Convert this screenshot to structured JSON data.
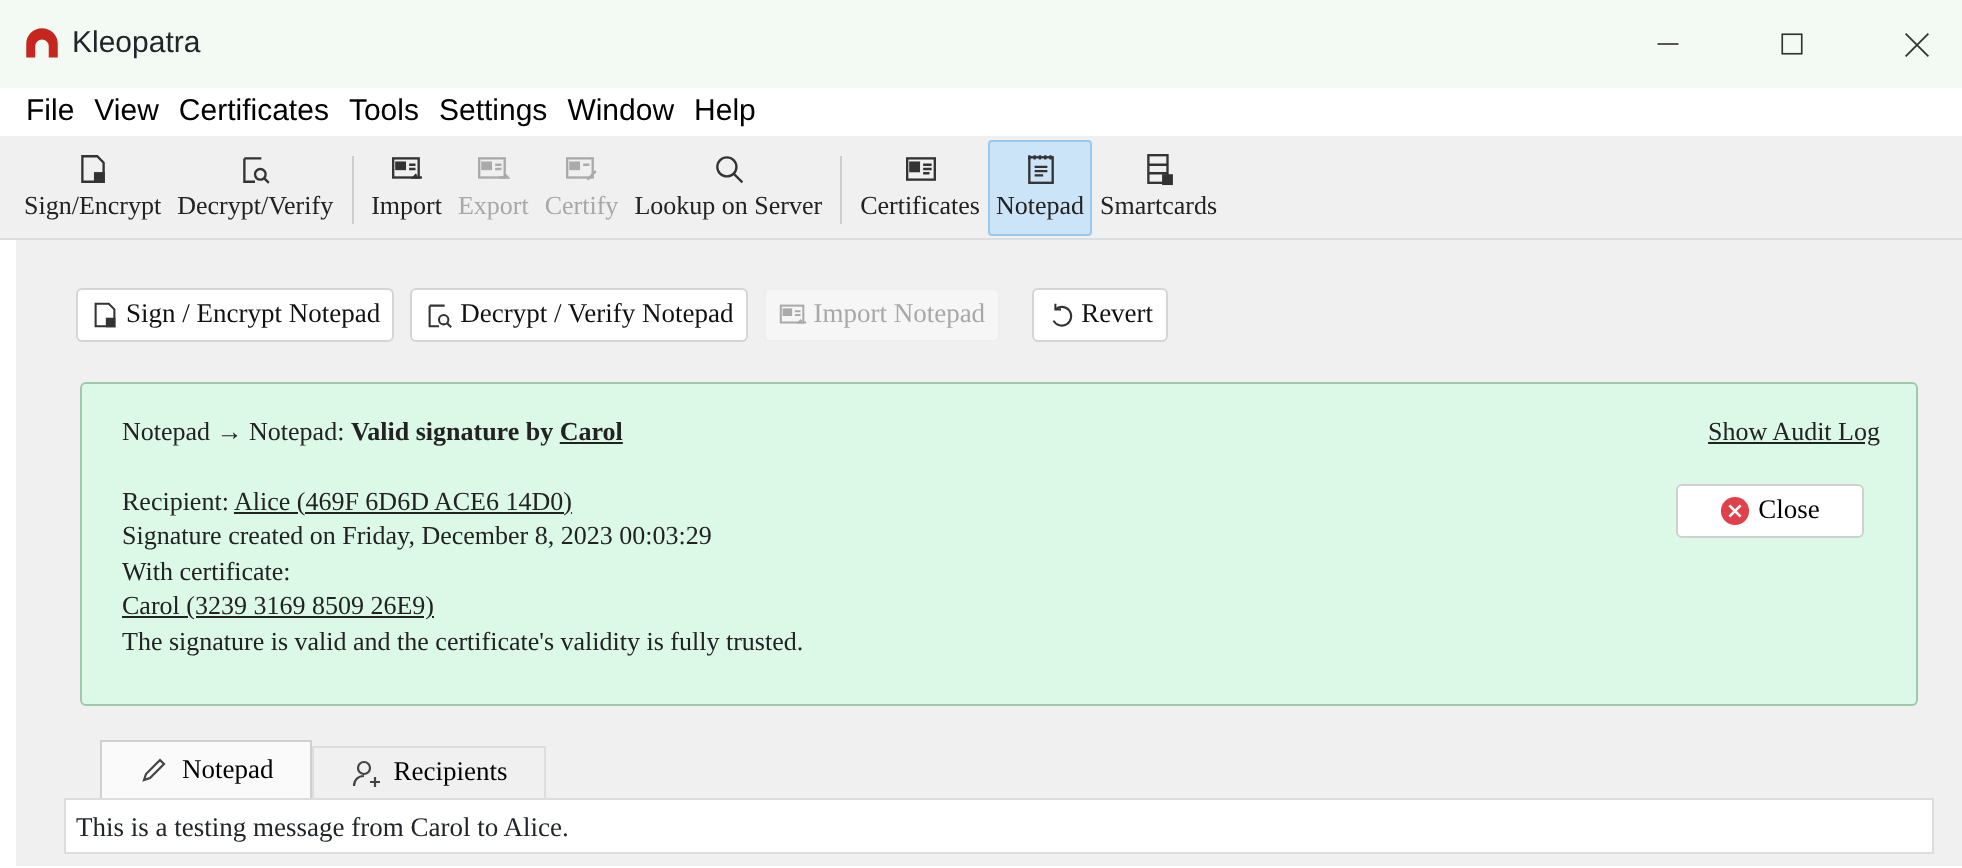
{
  "window": {
    "title": "Kleopatra"
  },
  "menu": [
    "File",
    "View",
    "Certificates",
    "Tools",
    "Settings",
    "Window",
    "Help"
  ],
  "toolbar_groups": [
    [
      {
        "label": "Sign/Encrypt",
        "disabled": false,
        "selected": false
      },
      {
        "label": "Decrypt/Verify",
        "disabled": false,
        "selected": false
      }
    ],
    [
      {
        "label": "Import",
        "disabled": false,
        "selected": false
      },
      {
        "label": "Export",
        "disabled": true,
        "selected": false
      },
      {
        "label": "Certify",
        "disabled": true,
        "selected": false
      },
      {
        "label": "Lookup on Server",
        "disabled": false,
        "selected": false
      }
    ],
    [
      {
        "label": "Certificates",
        "disabled": false,
        "selected": false
      },
      {
        "label": "Notepad",
        "disabled": false,
        "selected": true
      },
      {
        "label": "Smartcards",
        "disabled": false,
        "selected": false
      }
    ]
  ],
  "actions": [
    {
      "label": "Sign / Encrypt Notepad",
      "disabled": false
    },
    {
      "label": "Decrypt / Verify Notepad",
      "disabled": false
    },
    {
      "label": "Import Notepad",
      "disabled": true
    },
    {
      "label": "Revert",
      "disabled": false
    }
  ],
  "result": {
    "heading": "Notepad → Notepad: **Valid signature by**",
    "signer_link": "Carol",
    "audit_link": "Show Audit Log",
    "close_button": "Close",
    "lines": [
      {
        "kind": "labeled",
        "label": "Recipient:",
        "link": "Alice (469F 6D6D ACE6 14D0)"
      },
      {
        "kind": "text",
        "text": "Signature created on Friday, December 8, 2023 00:03:29"
      },
      {
        "kind": "text",
        "text": "With certificate:"
      },
      {
        "kind": "link",
        "link": "Carol (3239 3169 8509 26E9)"
      },
      {
        "kind": "text",
        "text": "The signature is valid and the certificate's validity is fully trusted."
      }
    ]
  },
  "tabs": [
    {
      "label": "Notepad",
      "selected": true
    },
    {
      "label": "Recipients",
      "selected": false
    }
  ],
  "editor": {
    "text": "This is a testing message from Carol to Alice."
  }
}
